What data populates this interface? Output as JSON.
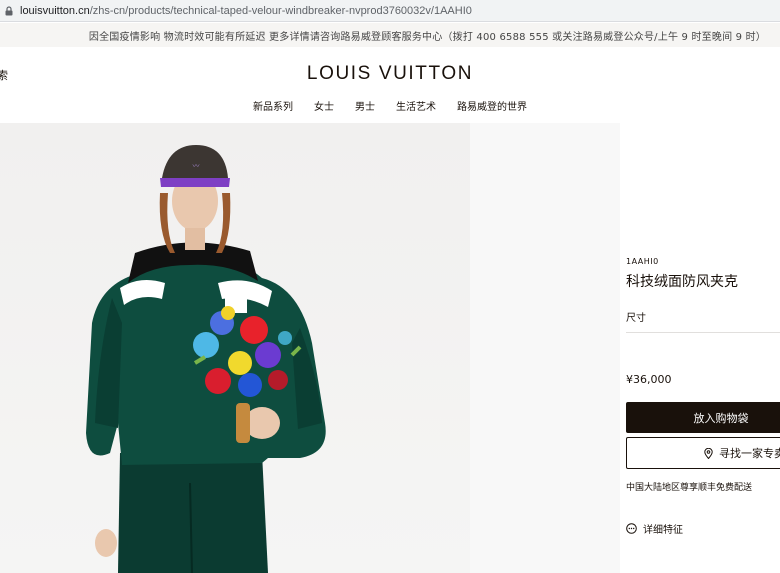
{
  "browser": {
    "url_host": "louisvuitton.cn",
    "url_path": "/zhs-cn/products/technical-taped-velour-windbreaker-nvprod3760032v/1AAHI0"
  },
  "notice": {
    "text": "因全国疫情影响 物流时效可能有所延迟 更多详情请咨询路易威登顾客服务中心（拨打 400 6588 555 或关注路易威登公众号/上午 9 时至晚间 9 时）"
  },
  "header": {
    "search_fragment": "索",
    "logo": "LOUIS VUITTON",
    "nav": [
      "新品系列",
      "女士",
      "男士",
      "生活艺术",
      "路易威登的世界"
    ]
  },
  "product": {
    "sku": "1AAHI0",
    "name": "科技绒面防风夹克",
    "size_label": "尺寸",
    "price": "¥36,000",
    "add_to_cart": "放入购物袋",
    "find_store": "寻找一家专卖店",
    "delivery_note": "中国大陆地区尊享顺丰免费配送",
    "details_label": "详细特征"
  },
  "colors": {
    "primary": "#19110b",
    "jacket": "#0d4a3c",
    "background": "#f2f1f0"
  }
}
